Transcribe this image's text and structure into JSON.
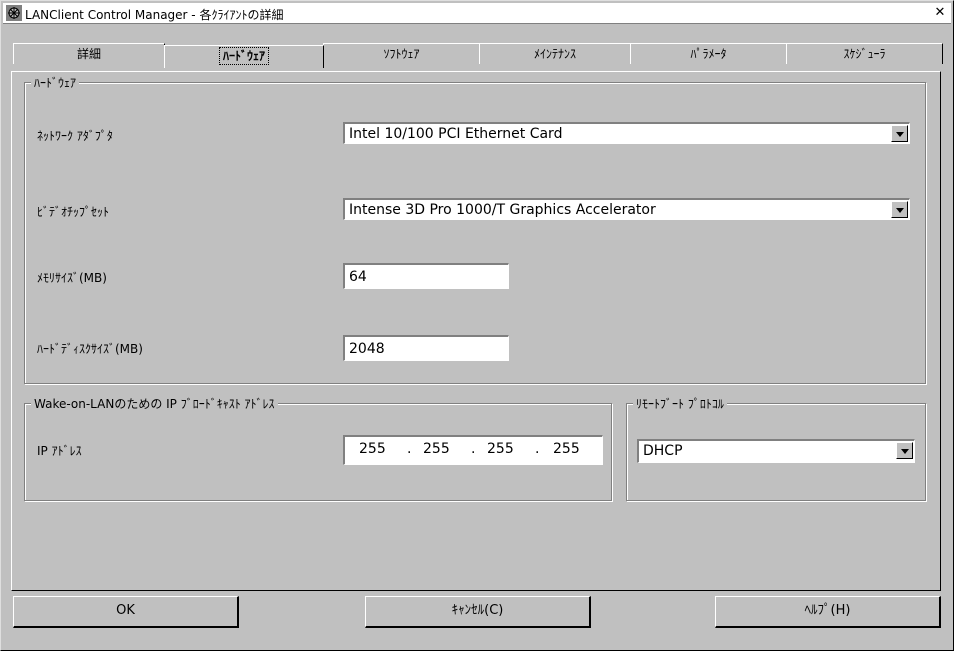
{
  "window": {
    "title": "LANClient Control Manager - 各ｸﾗｲｱﾝﾄの詳細",
    "close_glyph": "✕"
  },
  "tabs": [
    {
      "label": "詳細"
    },
    {
      "label": "ﾊｰﾄﾞｳｪｱ",
      "active": true
    },
    {
      "label": "ｿﾌﾄｳｪｱ"
    },
    {
      "label": "ﾒｲﾝﾃﾅﾝｽ"
    },
    {
      "label": "ﾊﾟﾗﾒｰﾀ"
    },
    {
      "label": "ｽｹｼﾞｭｰﾗ"
    }
  ],
  "hardware": {
    "group_label": "ﾊｰﾄﾞｳｪｱ",
    "network_adapter": {
      "label": "ﾈｯﾄﾜｰｸ ｱﾀﾞﾌﾟﾀ",
      "value": "Intel 10/100 PCI Ethernet Card"
    },
    "video_chipset": {
      "label": "ﾋﾞﾃﾞｵﾁｯﾌﾟｾｯﾄ",
      "value": "Intense 3D Pro 1000/T Graphics Accelerator"
    },
    "memory_size": {
      "label": "ﾒﾓﾘｻｲｽﾞ(MB)",
      "value": "64"
    },
    "disk_size": {
      "label": "ﾊｰﾄﾞﾃﾞｨｽｸｻｲｽﾞ(MB)",
      "value": "2048"
    }
  },
  "wol": {
    "group_label": "Wake-on-LANのための IP ﾌﾞﾛｰﾄﾞｷｬｽﾄ ｱﾄﾞﾚｽ",
    "ip_label": "IP ｱﾄﾞﾚｽ",
    "ip": [
      "255",
      "255",
      "255",
      "255"
    ],
    "dot": "."
  },
  "boot": {
    "group_label": "ﾘﾓｰﾄﾌﾞｰﾄ ﾌﾟﾛﾄｺﾙ",
    "value": "DHCP"
  },
  "buttons": {
    "ok": "OK",
    "cancel": "ｷｬﾝｾﾙ(C)",
    "help": "ﾍﾙﾌﾟ(H)"
  },
  "icons": {
    "app": "app-icon",
    "close": "close-icon",
    "dropdown": "chevron-down-icon"
  }
}
